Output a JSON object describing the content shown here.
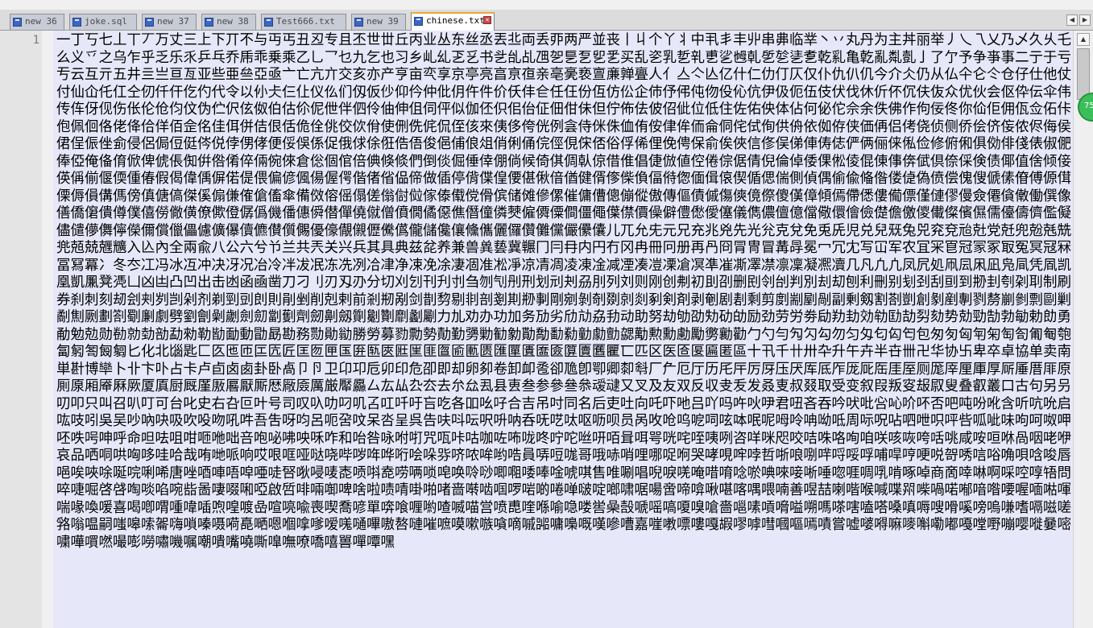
{
  "tabs": [
    {
      "label": "new 36",
      "active": false
    },
    {
      "label": "joke.sql",
      "active": false
    },
    {
      "label": "new 37",
      "active": false
    },
    {
      "label": "new 38",
      "active": false
    },
    {
      "label": "Test666.txt",
      "active": false
    },
    {
      "label": "new 39",
      "active": false
    },
    {
      "label": "chinese.txt",
      "active": true
    }
  ],
  "editor": {
    "line_number": "1",
    "text": "一丁丂七丄丅丆万丈三上下丌不与丏丐丑丒专且丕世丗丘丙业丛东丝丞丟丠両丢丣两严並丧丨丩个丫丬中丮丯丰丱串丳临丵丶丷丸丹为主丼丽举丿乀乁乂乃乄久乆乇么义乊之乌乍乎乏乐乑乒乓乔乕乖乗乘乙乚乛乜九乞也习乡乢乣乤乥书乧乨乩乪乫乬乭乮乯买乱乲乳乴乵乶乷乸乹乺乻乼乽乾乿亀亁亂亃亄亅了亇予争亊事二亍于亏亐云互亓五井亖亗亘亙亚些亜亝亞亟亠亡亢亣交亥亦产亨亩亪享京亭亮亯亰亱亲亳亴亵亶亷亸亹人亻亼亽亾亿什仁仂仃仄仅仆仇仈仉今介仌仍从仏仐仑仒仓仔仕他仗付仙仚仛仜仝仞仟仠仡仢代令以仦仧仨仩仪仫们仭仮仯仰仱仲仳仴仵件价仸仹仺任仼份仾仿伀企伂伃伄伅伆伇伈伉伊伋伌伍伎伏伐休伒伓伔伕伖众优伙会伛伜伝伞伟传伡伢伣伤伥伦伧伨伩伪伫伬伭伮伯估伱伲伳伴伵伶伷伸伹伺伻似伽伾伿佀佁佂佃佄佅但佇佈佉佊佋佌位低住佐佑佒体佔何佖佗佘余佚佛作佝佞佟你佡佢佣佤佥佦佧佨佩佪佫佬佭佮佯佰佱佲佳佴併佶佷佸佹佺佻佼佽佾使侀侁侂侃侄侅來侇侈侉侊例侌侍侎侏侐侑侒侓侔侕侖侗侘侙侚供侜依侞侟侠価侢侣侤侥侦侧侨侩侪侫侬侭侮侯侰侱侲侳侴侵侶侷侸侹侺侻侼侽侾便俀俁係促俄俅俆俇俈俉俊俋俌俍俎俏俐俑俒俓俔俕俖俗俘俙俚俛俜保俞俟俠信俢俣俤俥俦俧俨俩俪俫俬俭修俯俰俱俲俳俴俵俶俷俸俹俺俻俼俽俾俿倀倁倂倃倄倅倆倇倈倉倊個倌倍倎倏倐們倒倓倔倕倖倗倘候倚倛倜倝倞借倠倡倢倣値倥倦倧倨倩倪倫倬倭倮倯倰倱倲倳倴倵倶倷倸倹债倻值倽倾倿偀偁偂偃偄偅偆假偈偉偊偋偌偍偎偏偐偑偒偓偔偕偖偗偘偙做偛停偝偞偟偠偡偢偣偤健偦偧偨偩偪偫偬偭偮偯偰偱偲偳側偵偶偷偸偹偺偻偼偽偾偿傀傁傂傃傄傅傆傇傈傉傊傋傌傍傎傏傐傑傒傓傔傕傖傗傘備傚傛傜傝傞傟傠傡傢傣傤傥傦傧储傩傪傫催傭傮傯傰傱傲傳傴債傶傷傸傹傺傻傼傽傾傿僀僁僂僃僄僅僆僇僈僉僊僋僌働僎像僐僑僒僓僔僕僖僗僘僙僚僛僜僝僞僟僠僡僢僣僤僥僦僧僨僩僪僫僬僭僮僯僰僱僲僳僴僵僶僷僸價僺僻僼僽僾僿儀儁儂儃億儅儆儇儈儉儊儋儌儍儎儏儐儑儒儓儔儕儖儗儘儙儚儛儜儝儞償儠儡儢儣儤儥儦儧儨儩優儫儬儭儮儯儰儱儲儳儴儵儶儷儸儹儺儻儼儽儾儿兀允兂元兄充兆兇先光兊克兌免兎兏児兑兒兓兔兕兖兗兘兙党兛兜兝兞兟兠兡兢兣兤入兦內全兩兪八公六兮兯兰共兲关兴兵其具典兹兺养兼兽兾兿冀冁冂冃冄内円冇冈冉冊冋册再冎冏冐冑冒冓冔冕冖冗冘写冚军农冝冞冟冠冡冢冣冤冥冦冧冨冩冪冫冬冭冮冯冰冱冲决冴况冶冷冸冹冺冻冼冽冾冿净凁凂凃凄凅准凇凈凉凊凋凌凍凎减凐凑凒凓凔凕凖凗凘凙凚凛凜凝凞凟几凡凢凣凤凥処凧凨凩凪凫凬凭凮凯凰凱凲凳凴凵凶凷凸凹出击凼函凾凿刀刁刂刃刄刅分切刈刉刊刋刌刍刎刏刐刑划刓刔刕刖列刘则刚创刜初刞刟删刡刢刣判別刦刧刨利刪别刬刭刮刯到刱刲刳刴刵制刷券刹刺刻刼刽刾刿剀剁剂剃剄剅剆則剈剉削剋剌前剎剏剐剑剒剓剔剕剖剗剘剙剚剛剜剝剞剟剠剡剢剣剤剥剦剧剨剩剪剫剬剭剮副剰剱割剳剴創剶剷剸剹剺剻剼剽剾剿劀劁劂劃劄劅劆劇劈劉劊劋劌劍劎劏劐劑劒劓劔劕劖劗劘劙劚力劜劝办功加务劢劣劤劥劦劧动助努劫劬劭劮劯劰励劲劳労劵劶劷劸効劺劻劼劽劾势勀勁勂勃勄勅勆勇勈勉勊勋勌勍勎勏勐勑勒勓勔動勖勗勘務勚勛勜勝勞募勠勡勢勣勤勥勦勧勨勩勪勫勬勭勮勯勰勱勲勳勴勵勶勷勸勹勺勻勼勽勾勿匀匁匂匃匄包匆匇匈匉匊匋匌匍匎匏匐匑匒匓匔匕化北匘匙匚匛匜匝匞匟匠匡匢匣匤匥匦匧匨匩匪匫匬匭匮匯匰匱匲匳匴匵匶匷匸匹区医匼匽匾匿區十卂千卄卅卆升午卉半卋卌卍华协卐卑卒卓協单卖南単卙博卛卜卝卞卟占卡卢卣卤卥卦卧卨卩卪卫卬卭卮卯印危卲即却卵卶卷卸卹卺卻卼卽卾卿厀厁厂厃厄厅历厇厈厉厊压厌厍厎厏厐厑厒厓厔厕厖厗厘厙厚厛厜厝厞原厠厡厢厣厤厥厦厧厨厩厪厫厬厭厮厯厰厱厲厳厴厵厶厷厸厹厺去厼厽厾县叀叁参參叄叅叆叇又叉及友双反収叏叐发叒叓叔叕取受变叙叚叛叜叝叞叟叠叡叢口古句另叧叨叩只叫召叭叮可台叱史右叴叵叶号司叹叺叻叼叽叾叿吀吁吂吃各吅吆吇合吉吊吋同名后吏吐向吒吓吔吕吖吗吘吙吚君吜吝吞吟吠吡吢吣吤吥否吧吨吩吪含听吭吮启吰吱吲吳吴吵吶吷吸吹吺吻吼吽吾吿呀呁呂呃呄呅呆呇呈呉告呋呌呍呎呏呐呑呒呓呔呕呖呗员呙呚呛呜呝呞呟呠呡呢呣呤呥呦呧周呩呪呫呬呭呮呯呰呱呲味呴呵呶呷呸呹呺呻呼命呾呿咀咁咂咃咄咅咆咇咈咉咊咋和咍咎咏咐咑咒咓咔咕咖咗咘咙咚咛咜咝咞咟咠咡咢咣咤咥咦咧咨咩咪咫咬咭咮咯咰咱咲咳咴咵咶咷咸咹咺咻咼咽咾咿哀品哂哃哄哅哆哇哈哉哊哋哌响哎哏哐哑哒哓哔哕哖哗哘哙哚哛哜哝哞哟哠員哢哣哤哥哦哧哨哩哪哫哬哭哮哯哰哱哲哳哴哵哶哷哸哹哺哻哼哽哾哿唀唁唂唃唄唅唆唇唈唉唊唋唌唍唎唏唐唑唒唓唔唕唖唗唘唙唚唛唜唝唞唟唠唡唢唣唤唥唦唧唨唩唪唫唬唭售唯唰唱唲唳唴唵唶唷唸唹唺唻唼唽唾唿啀啁啂啃啄啅商啇啈啉啊啋啌啍啎問啐啑啒啓啔啕啖啗啘啙啚啛啜啝啞啟啠啡啢啣啤啥啦啧啨啩啪啫啬啭啮啯啰啱啲啳啴啵啶啷啸啹啺啻啼啽啾啿喀喁喂喃善喅喆喇喈喉喊喋喌喍喎喏喐喑喒喓喔喕喖喗喘喙喚喛喜喝喞喟喠喡喢喣喤喥喦喧喨喩喪喫喬喭單喯喰喱喲喳喴喵営喷喸喹喺喻喼喽喾喿嗀嗁嗂嗃嗄嗅嗆嗇嗈嗉嗊嗋嗌嗍嗎嗏嗐嗑嗒嗓嗔嗕嗖嗗嗘嗙嗚嗛嗜嗝嗞嗟嗠嗡嗢嗣嗤嗥嗦嗧嗨嗩嗪嗫嗬嗭嗮嗯嗰嗱嗲嗳嗴嗵嗶嗷嗸嗹嗺嗻嗼嗽嗾嗿嘀嘁嘂嘃嘄嘅嘆嘇嘈嘉嘊嘋嘌嘍嘎嘏嘐嘑嘒嘓嘔嘕嘖嘗嘘嘙嘚嘛嘜嘝嘞嘟嘠嘡嘢嘣嘤嘥嘦嘧嘨嘩嘪嘫嘬嘭嘮嘯嘰嘱嘲嘳嘴嘵嘶嘷嘸嘹嘺嘻嘼嘽嘾嘿"
  },
  "scrollbar": {
    "up_arrow": "▲"
  },
  "tab_nav": {
    "left": "◀",
    "right": "▶"
  },
  "badge": {
    "text": "75"
  },
  "colors": {
    "editor_bg": "#e6e8fa",
    "gutter_bg": "#e4e4e4",
    "active_tab_accent": "#f0a43c",
    "badge": "#3cbf5a"
  }
}
